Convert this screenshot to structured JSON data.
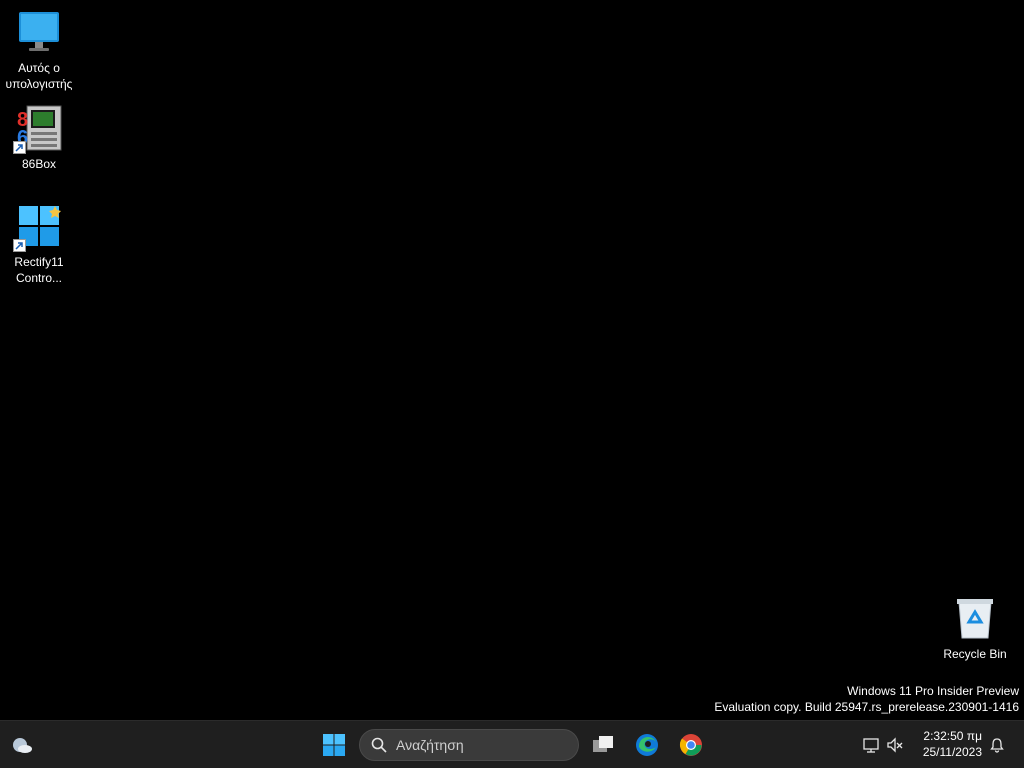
{
  "desktop": {
    "icons": [
      {
        "label": "Αυτός ο υπολογιστής",
        "icon": "monitor-icon"
      },
      {
        "label": "86Box",
        "icon": "86box-icon"
      },
      {
        "label": "Rectify11 Contro...",
        "icon": "windows-logo-icon"
      },
      {
        "label": "Recycle Bin",
        "icon": "recycle-bin-icon"
      }
    ],
    "watermark": {
      "line1": "Windows 11 Pro Insider Preview",
      "line2": "Evaluation copy. Build 25947.rs_prerelease.230901-1416"
    }
  },
  "taskbar": {
    "widgets_icon": "weather-icon",
    "start_icon": "windows-start-icon",
    "search": {
      "placeholder": "Αναζήτηση"
    },
    "pinned": [
      "task-view-icon",
      "edge-icon",
      "chrome-icon"
    ],
    "tray": {
      "time": "2:32:50 πμ",
      "date": "25/11/2023"
    }
  }
}
